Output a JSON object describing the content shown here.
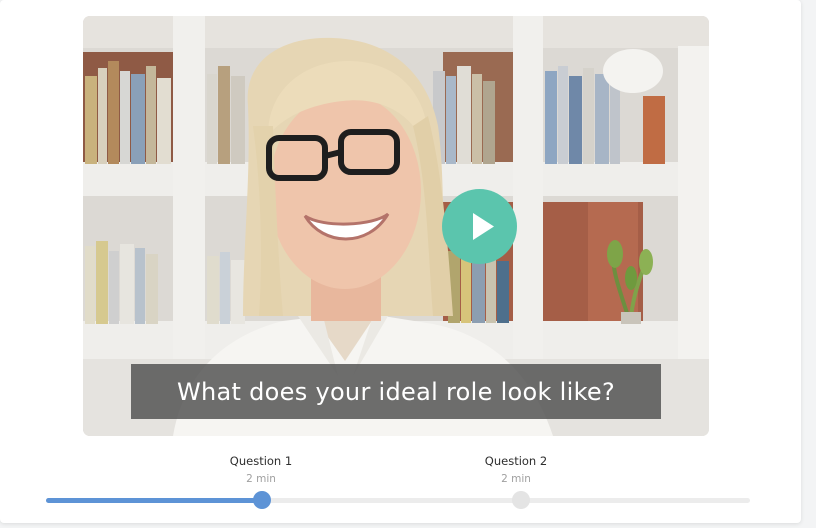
{
  "video": {
    "caption": "What does your ideal role look like?",
    "play_icon": "play-icon"
  },
  "questions": [
    {
      "label": "Question 1",
      "duration": "2 min"
    },
    {
      "label": "Question 2",
      "duration": "2 min"
    }
  ],
  "progress": {
    "fraction": 0.307,
    "current_question": 1
  },
  "colors": {
    "accent_play": "#5bc5ad",
    "progress_fill": "#5d93d6",
    "progress_track": "#ececec",
    "inactive_marker": "#e4e4e4"
  }
}
